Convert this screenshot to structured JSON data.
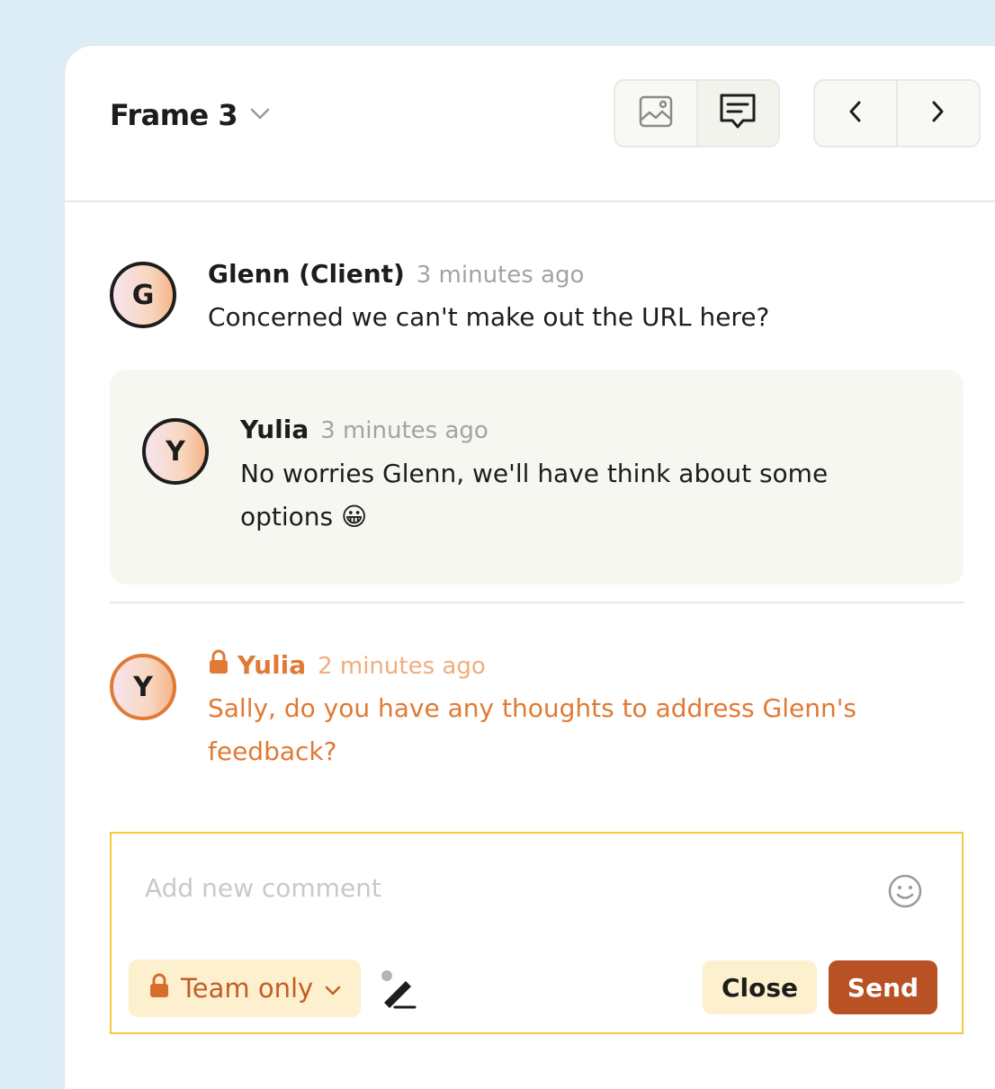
{
  "header": {
    "frame_title": "Frame 3",
    "view_buttons": [
      {
        "icon": "image-icon"
      },
      {
        "icon": "comment-icon",
        "active": true
      }
    ],
    "nav_buttons": [
      {
        "icon": "chevron-left-icon"
      },
      {
        "icon": "chevron-right-icon"
      }
    ]
  },
  "comments": [
    {
      "initial": "G",
      "author": "Glenn (Client)",
      "time": "3 minutes ago",
      "text": "Concerned we can't make out the URL here?",
      "reply": {
        "initial": "Y",
        "author": "Yulia",
        "time": "3 minutes ago",
        "text": "No worries Glenn, we'll have think about some options",
        "emoji": "😀"
      }
    },
    {
      "initial": "Y",
      "author": "Yulia",
      "time": "2 minutes ago",
      "text_line1": "Sally, do you have any thoughts to address Glenn's",
      "text_line2": "feedback?",
      "private": true
    }
  ],
  "composer": {
    "placeholder": "Add new comment",
    "visibility_label": "Team only",
    "close_label": "Close",
    "send_label": "Send"
  },
  "colors": {
    "accent": "#e07a35",
    "send": "#b85224",
    "composer_border": "#f5c842",
    "background": "#dcedf5"
  }
}
